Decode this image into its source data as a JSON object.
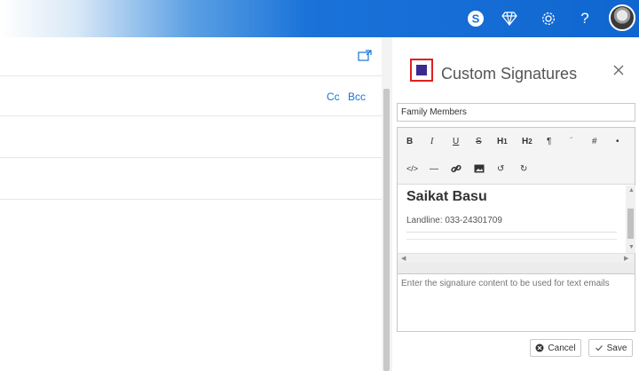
{
  "topbar": {
    "icons": [
      "skype-icon",
      "diamond-icon",
      "gear-icon",
      "help-icon",
      "avatar"
    ],
    "help_glyph": "?"
  },
  "compose": {
    "cc_label": "Cc",
    "bcc_label": "Bcc"
  },
  "panel": {
    "title": "Custom Signatures",
    "signature_name": "Family Members",
    "toolbar": {
      "bold": "B",
      "italic": "I",
      "underline": "U",
      "strike": "S",
      "h1": "H",
      "h1_sub": "1",
      "h2": "H",
      "h2_sub": "2",
      "paragraph": "¶",
      "quote": "ˆ",
      "hash": "#",
      "bullet": "•",
      "code": "</>",
      "rule": "—",
      "undo": "↺",
      "redo": "↻"
    },
    "signature_content": {
      "name": "Saikat Basu",
      "landline": "Landline: 033-24301709"
    },
    "text_signature_placeholder": "Enter the signature content to be used for text emails",
    "cancel_label": "Cancel",
    "save_label": "Save"
  }
}
